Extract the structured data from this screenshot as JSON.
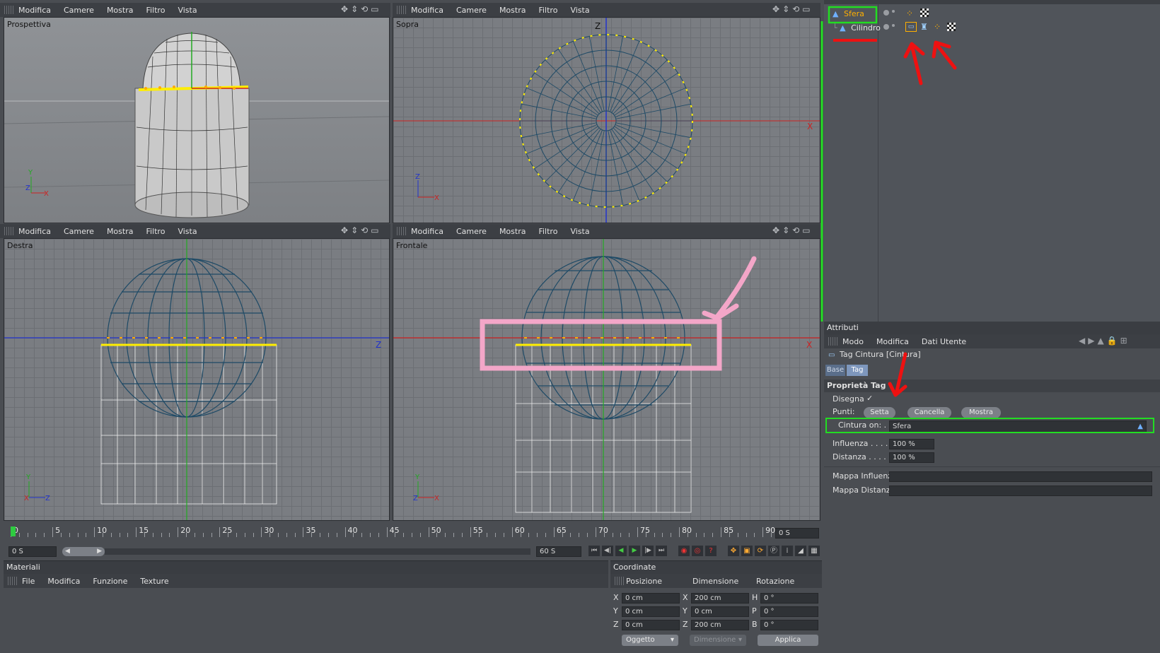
{
  "viewports": {
    "menu": [
      "Modifica",
      "Camere",
      "Mostra",
      "Filtro",
      "Vista"
    ],
    "perspective": {
      "label": "Prospettiva"
    },
    "top": {
      "label": "Sopra"
    },
    "right": {
      "label": "Destra"
    },
    "front": {
      "label": "Frontale"
    },
    "axis": {
      "x": "X",
      "y": "Y",
      "z": "Z"
    }
  },
  "objects": {
    "items": [
      {
        "name": "Sfera",
        "color": "#ffb000"
      },
      {
        "name": "Cilindro",
        "color": "#e6e6e6"
      }
    ]
  },
  "attributes": {
    "title": "Attributi",
    "menu": [
      "Modo",
      "Modifica",
      "Dati Utente"
    ],
    "tag_name": "Tag Cintura [Cintura]",
    "tabs": [
      "Base",
      "Tag"
    ],
    "section": "Proprietà Tag",
    "disegna_label": "Disegna",
    "disegna_check": "✓",
    "punti_label": "Punti:",
    "buttons": [
      "Setta",
      "Cancella",
      "Mostra"
    ],
    "cintura_label": "Cintura on: . .",
    "cintura_value": "Sfera",
    "influenza_label": "Influenza . . . . .",
    "influenza_value": "100 %",
    "distanza_label": "Distanza . . . . . .",
    "distanza_value": "100 %",
    "mappa_influenza": "Mappa Influenza",
    "mappa_distanza": "Mappa Distanza"
  },
  "timeline": {
    "ticks": [
      "0",
      "5",
      "10",
      "15",
      "20",
      "25",
      "30",
      "35",
      "40",
      "45",
      "50",
      "55",
      "60",
      "65",
      "70",
      "75",
      "80",
      "85",
      "90"
    ],
    "current_right": "0 S",
    "start": "0 S",
    "end": "60 S"
  },
  "materials": {
    "title": "Materiali",
    "menu": [
      "File",
      "Modifica",
      "Funzione",
      "Texture"
    ]
  },
  "coordinates": {
    "title": "Coordinate",
    "headers": [
      "Posizione",
      "Dimensione",
      "Rotazione"
    ],
    "rows": [
      {
        "a": "X",
        "pos": "0 cm",
        "b": "X",
        "dim": "200 cm",
        "c": "H",
        "rot": "0 °"
      },
      {
        "a": "Y",
        "pos": "0 cm",
        "b": "Y",
        "dim": "0 cm",
        "c": "P",
        "rot": "0 °"
      },
      {
        "a": "Z",
        "pos": "0 cm",
        "b": "Z",
        "dim": "200 cm",
        "c": "B",
        "rot": "0 °"
      }
    ],
    "mode": "Oggetto",
    "mode2": "Dimensione",
    "apply": "Applica"
  },
  "colors": {
    "highlight_green": "#22dd22",
    "arrow_red": "#ee1111",
    "annotation_pink": "#f3a6c8",
    "point_yellow": "#ffee00"
  }
}
